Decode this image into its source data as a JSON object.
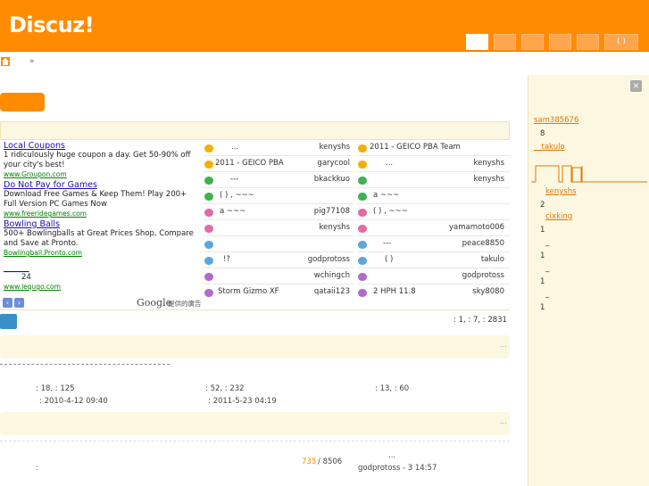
{
  "header": {
    "logo": "Discuz!",
    "search_label": "( )"
  },
  "breadcrumb": {
    "sep": "»"
  },
  "colors": {
    "brand": "#ff8c00",
    "swatches": [
      "#2255aa",
      "#ff8c00",
      "#33aa55",
      "#556677",
      "#333333",
      "#aa2222",
      "#ee5588",
      "#cc3399"
    ]
  },
  "ads": [
    {
      "title": "Local Coupons",
      "text": "1 ridiculously huge coupon a day. Get 50-90% off your city's best!",
      "url": "www.Groupon.com"
    },
    {
      "title": "Do Not Pay for Games",
      "text": "Download Free Games & Keep Them! Play 200+ Full Version PC Games Now",
      "url": "www.freeridegames.com"
    },
    {
      "title": "Bowling Balls",
      "text": "500+ Bowlingballs at Great Prices Shop, Compare and Save at Pronto.",
      "url": "Bowlingball.Pronto.com"
    },
    {
      "title": "______",
      "text": "24",
      "url": "www.lequgo.com"
    }
  ],
  "ad_footer": {
    "google": "Google",
    "label": "提供的廣告"
  },
  "threads_left": [
    {
      "icon": "#f2b100",
      "title": "...",
      "user": "kenyshs"
    },
    {
      "icon": "#f2b100",
      "title": "2011 - GEICO PBA",
      "user": "garycool"
    },
    {
      "icon": "#3cb44b",
      "title": "---",
      "user": "bkackkuo"
    },
    {
      "icon": "#3cb44b",
      "title": "( ) ,     ~~~",
      "user": ""
    },
    {
      "icon": "#e36aa7",
      "title": "a ~~~",
      "user": "pig77108"
    },
    {
      "icon": "#e36aa7",
      "title": "",
      "user": "kenyshs"
    },
    {
      "icon": "#5aa7e0",
      "title": "",
      "user": ""
    },
    {
      "icon": "#5aa7e0",
      "title": "!?",
      "user": "godprotoss"
    },
    {
      "icon": "#b06ad0",
      "title": "",
      "user": "wchingch"
    },
    {
      "icon": "#b06ad0",
      "title": "Storm Gizmo XF",
      "user": "qataii123"
    }
  ],
  "threads_right": [
    {
      "icon": "#f2b100",
      "title": "2011 - GEICO PBA Team",
      "user": ""
    },
    {
      "icon": "#f2b100",
      "title": "...",
      "user": "kenyshs"
    },
    {
      "icon": "#3cb44b",
      "title": "",
      "user": "kenyshs"
    },
    {
      "icon": "#3cb44b",
      "title": "a ~~~",
      "user": ""
    },
    {
      "icon": "#e36aa7",
      "title": "( ) ,     ~~~",
      "user": ""
    },
    {
      "icon": "#e36aa7",
      "title": "",
      "user": "yamamoto006"
    },
    {
      "icon": "#5aa7e0",
      "title": "---",
      "user": "peace8850"
    },
    {
      "icon": "#5aa7e0",
      "title": "(     )",
      "user": "takulo"
    },
    {
      "icon": "#b06ad0",
      "title": "",
      "user": "godprotoss"
    },
    {
      "icon": "#b06ad0",
      "title": "2 HPH    11.8",
      "user": "sky8080"
    }
  ],
  "stats": {
    "summary": ": 1,   : 7,   : 2831"
  },
  "forum_stats": [
    {
      "counts": ": 18,   : 125",
      "date": ": 2010-4-12 09:40"
    },
    {
      "counts": ": 52,   : 232",
      "date": ": 2011-5-23 04:19"
    },
    {
      "counts": ": 13,   : 60",
      "date": ""
    }
  ],
  "bottom": {
    "colon": ":",
    "today": "735",
    "total": "/ 8506",
    "dots": "...",
    "last": "godprotoss - 3    14:57"
  },
  "ellipsis": "...",
  "sidebar": {
    "close": "×",
    "items": [
      {
        "name": "sam385676",
        "num": "8"
      },
      {
        "name": "__takulo",
        "num": ""
      },
      {
        "name": "kenyshs",
        "num": "2"
      },
      {
        "name": "cixking",
        "num": "1"
      },
      {
        "name": "_",
        "num": "1"
      },
      {
        "name": "_",
        "num": "1"
      },
      {
        "name": "_",
        "num": "1"
      }
    ]
  }
}
